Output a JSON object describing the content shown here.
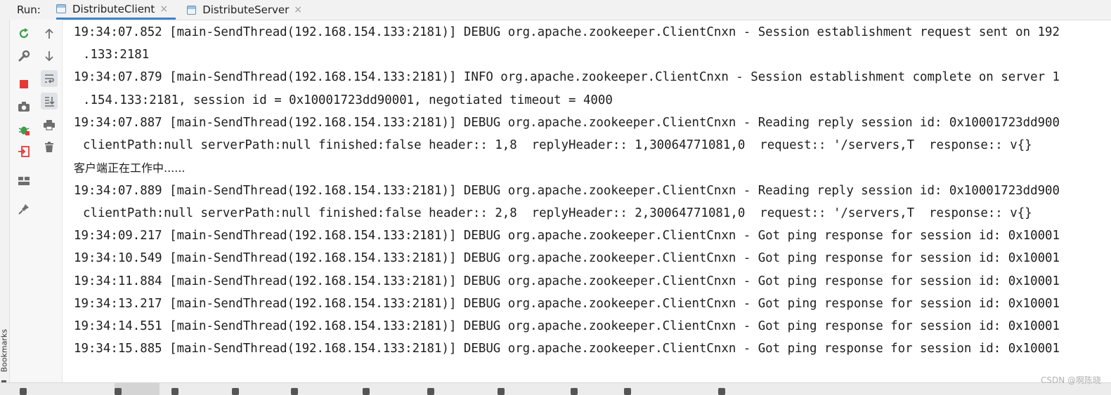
{
  "run_bar": {
    "label": "Run:",
    "tabs": [
      {
        "label": "DistributeClient",
        "close": "×",
        "active": true
      },
      {
        "label": "DistributeServer",
        "close": "×",
        "active": false
      }
    ]
  },
  "sidebar": {
    "bookmarks_label": "Bookmarks",
    "tools_col1": [
      {
        "icon": "rerun-icon",
        "glyph": "⟳"
      },
      {
        "icon": "wrench-icon",
        "glyph": "🔧"
      },
      {
        "icon": "stop-icon",
        "glyph": "■"
      },
      {
        "icon": "camera-icon",
        "glyph": "📷"
      },
      {
        "icon": "debug-bug-icon",
        "glyph": "🐞"
      },
      {
        "icon": "exit-icon",
        "glyph": "⇥"
      },
      {
        "icon": "layout-icon",
        "glyph": "▦"
      },
      {
        "icon": "pin-icon",
        "glyph": "📌"
      }
    ],
    "tools_col2": [
      {
        "icon": "arrow-up-icon",
        "glyph": "↑"
      },
      {
        "icon": "arrow-down-icon",
        "glyph": "↓"
      },
      {
        "icon": "soft-wrap-icon",
        "glyph": "↩"
      },
      {
        "icon": "scroll-to-end-icon",
        "glyph": "⇊"
      },
      {
        "icon": "print-icon",
        "glyph": "⎙"
      },
      {
        "icon": "trash-icon",
        "glyph": "🗑"
      }
    ]
  },
  "console": {
    "lines": [
      {
        "text": "19:34:07.852 [main-SendThread(192.168.154.133:2181)] DEBUG org.apache.zookeeper.ClientCnxn - Session establishment request sent on 192",
        "kind": "log"
      },
      {
        "text": ".133:2181",
        "kind": "cont"
      },
      {
        "text": "19:34:07.879 [main-SendThread(192.168.154.133:2181)] INFO org.apache.zookeeper.ClientCnxn - Session establishment complete on server 1",
        "kind": "log"
      },
      {
        "text": ".154.133:2181, session id = 0x10001723dd90001, negotiated timeout = 4000",
        "kind": "cont"
      },
      {
        "text": "19:34:07.887 [main-SendThread(192.168.154.133:2181)] DEBUG org.apache.zookeeper.ClientCnxn - Reading reply session id: 0x10001723dd900",
        "kind": "log"
      },
      {
        "text": "clientPath:null serverPath:null finished:false header:: 1,8  replyHeader:: 1,30064771081,0  request:: '/servers,T  response:: v{}",
        "kind": "cont"
      },
      {
        "text": "客户端正在工作中......",
        "kind": "cjk"
      },
      {
        "text": "19:34:07.889 [main-SendThread(192.168.154.133:2181)] DEBUG org.apache.zookeeper.ClientCnxn - Reading reply session id: 0x10001723dd900",
        "kind": "log"
      },
      {
        "text": "clientPath:null serverPath:null finished:false header:: 2,8  replyHeader:: 2,30064771081,0  request:: '/servers,T  response:: v{}",
        "kind": "cont"
      },
      {
        "text": "19:34:09.217 [main-SendThread(192.168.154.133:2181)] DEBUG org.apache.zookeeper.ClientCnxn - Got ping response for session id: 0x10001",
        "kind": "log"
      },
      {
        "text": "19:34:10.549 [main-SendThread(192.168.154.133:2181)] DEBUG org.apache.zookeeper.ClientCnxn - Got ping response for session id: 0x10001",
        "kind": "log"
      },
      {
        "text": "19:34:11.884 [main-SendThread(192.168.154.133:2181)] DEBUG org.apache.zookeeper.ClientCnxn - Got ping response for session id: 0x10001",
        "kind": "log"
      },
      {
        "text": "19:34:13.217 [main-SendThread(192.168.154.133:2181)] DEBUG org.apache.zookeeper.ClientCnxn - Got ping response for session id: 0x10001",
        "kind": "log"
      },
      {
        "text": "19:34:14.551 [main-SendThread(192.168.154.133:2181)] DEBUG org.apache.zookeeper.ClientCnxn - Got ping response for session id: 0x10001",
        "kind": "log"
      },
      {
        "text": "19:34:15.885 [main-SendThread(192.168.154.133:2181)] DEBUG org.apache.zookeeper.ClientCnxn - Got ping response for session id: 0x10001",
        "kind": "log"
      }
    ]
  },
  "watermark": "CSDN @啊陈晓",
  "colors": {
    "accent": "#4083c9",
    "stop_red": "#e53935",
    "rerun_green": "#3c9d4e",
    "console_text": "#1e1e1e"
  }
}
